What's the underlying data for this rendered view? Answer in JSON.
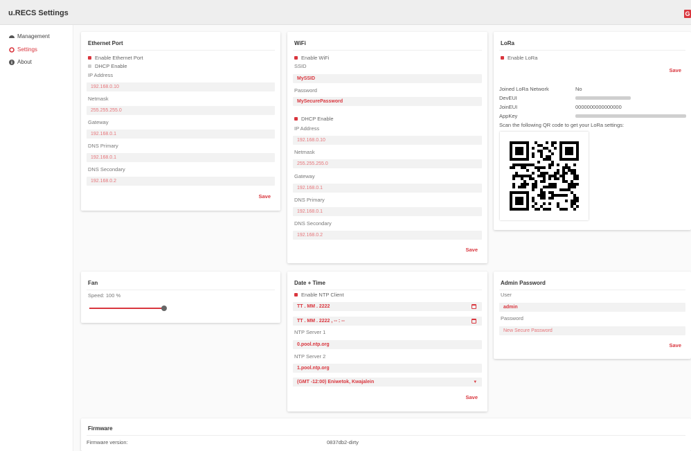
{
  "app": {
    "title": "u.RECS Settings",
    "logout_glyph": "G"
  },
  "sidebar": {
    "items": [
      {
        "label": "Management",
        "icon": "dashboard-icon"
      },
      {
        "label": "Settings",
        "icon": "gear-icon"
      },
      {
        "label": "About",
        "icon": "info-icon"
      }
    ]
  },
  "ethernet": {
    "title": "Ethernet Port",
    "enable_label": "Enable Ethernet Port",
    "dhcp_label": "DHCP Enable",
    "ip_label": "IP Address",
    "ip": "192.168.0.10",
    "netmask_label": "Netmask",
    "netmask": "255.255.255.0",
    "gateway_label": "Gateway",
    "gateway": "192.168.0.1",
    "dns1_label": "DNS Primary",
    "dns1": "192.168.0.1",
    "dns2_label": "DNS Secondary",
    "dns2": "192.168.0.2",
    "save_label": "Save"
  },
  "wifi": {
    "title": "WiFi",
    "enable_label": "Enable WiFi",
    "ssid_label": "SSID",
    "ssid": "MySSID",
    "password_label": "Password",
    "password": "MySecurePassword",
    "dhcp_label": "DHCP Enable",
    "ip_label": "IP Address",
    "ip": "192.168.0.10",
    "netmask_label": "Netmask",
    "netmask": "255.255.255.0",
    "gateway_label": "Gateway",
    "gateway": "192.168.0.1",
    "dns1_label": "DNS Primary",
    "dns1": "192.168.0.1",
    "dns2_label": "DNS Secondary",
    "dns2": "192.168.0.2",
    "save_label": "Save"
  },
  "lora": {
    "title": "LoRa",
    "enable_label": "Enable LoRa",
    "save_label": "Save",
    "joined_label": "Joined LoRa Network",
    "joined": "No",
    "deveui_label": "DevEUI",
    "joineui_label": "JoinEUI",
    "joineui": "0000000000000000",
    "appkey_label": "AppKey",
    "qr_note": "Scan the following QR code to get your LoRa settings:"
  },
  "fan": {
    "title": "Fan",
    "speed_label": "Speed:",
    "speed": "100 %",
    "speed_fraction": 1.0
  },
  "datetime": {
    "title": "Date + Time",
    "ntp_enable_label": "Enable NTP Client",
    "date_value": "TT . MM . 2222",
    "datetime_value": "TT . MM . 2222 ,   -- : --",
    "ntp1_label": "NTP Server 1",
    "ntp1": "0.pool.ntp.org",
    "ntp2_label": "NTP Server 2",
    "ntp2": "1.pool.ntp.org",
    "timezone": "(GMT -12:00) Eniwetok, Kwajalein",
    "save_label": "Save"
  },
  "admin": {
    "title": "Admin Password",
    "user_label": "User",
    "user": "admin",
    "password_label": "Password",
    "password_placeholder": "New Secure Password",
    "save_label": "Save"
  },
  "firmware": {
    "title": "Firmware",
    "version_label": "Firmware version:",
    "version": "0837db2-dirty"
  },
  "colors": {
    "accent": "#d9363e"
  }
}
